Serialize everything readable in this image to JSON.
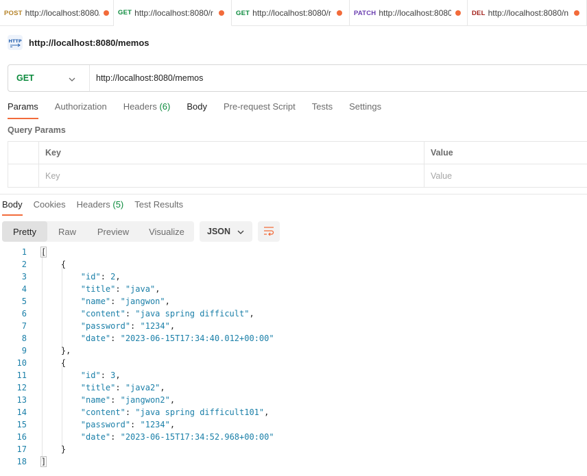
{
  "tabs": [
    {
      "method": "POST",
      "url": "http://localhost:8080/",
      "method_color": "#b6842a"
    },
    {
      "method": "GET",
      "url": "http://localhost:8080/r",
      "method_color": "#0b8a3c"
    },
    {
      "method": "GET",
      "url": "http://localhost:8080/r",
      "method_color": "#0b8a3c"
    },
    {
      "method": "PATCH",
      "url": "http://localhost:8080(",
      "method_color": "#6b3fb0"
    },
    {
      "method": "DEL",
      "url": "http://localhost:8080/n",
      "method_color": "#a3231d"
    }
  ],
  "request": {
    "title": "http://localhost:8080/memos",
    "method": "GET",
    "url": "http://localhost:8080/memos",
    "icon_text": "HTTP"
  },
  "request_tabs": {
    "params": "Params",
    "authorization": "Authorization",
    "headers": "Headers",
    "headers_count": "(6)",
    "body": "Body",
    "pre_request": "Pre-request Script",
    "tests": "Tests",
    "settings": "Settings"
  },
  "query_params": {
    "label": "Query Params",
    "col_key": "Key",
    "col_value": "Value",
    "key_placeholder": "Key",
    "value_placeholder": "Value"
  },
  "response_tabs": {
    "body": "Body",
    "cookies": "Cookies",
    "headers": "Headers",
    "headers_count": "(5)",
    "test_results": "Test Results"
  },
  "view": {
    "pretty": "Pretty",
    "raw": "Raw",
    "preview": "Preview",
    "visualize": "Visualize",
    "format": "JSON"
  },
  "code_lines": [
    "[",
    "    {",
    "        \"id\": 2,",
    "        \"title\": \"java\",",
    "        \"name\": \"jangwon\",",
    "        \"content\": \"java spring difficult\",",
    "        \"password\": \"1234\",",
    "        \"date\": \"2023-06-15T17:34:40.012+00:00\"",
    "    },",
    "    {",
    "        \"id\": 3,",
    "        \"title\": \"java2\",",
    "        \"name\": \"jangwon2\",",
    "        \"content\": \"java spring difficult101\",",
    "        \"password\": \"1234\",",
    "        \"date\": \"2023-06-15T17:34:52.968+00:00\"",
    "    }",
    "]"
  ],
  "colors": {
    "accent": "#f26b3a",
    "get": "#0b8a3c",
    "json_token": "#1a7fa8"
  }
}
